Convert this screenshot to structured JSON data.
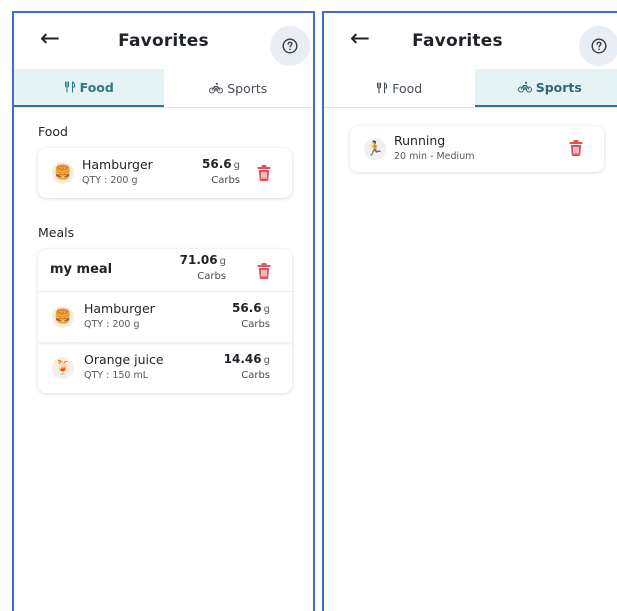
{
  "screens": [
    {
      "header": {
        "title": "Favorites",
        "back_icon": "arrow-left-icon",
        "help_icon": "help-circle-icon"
      },
      "tabs": [
        {
          "label": "Food",
          "icon": "fork-knife-icon",
          "active": true
        },
        {
          "label": "Sports",
          "icon": "bicycle-icon",
          "active": false
        }
      ],
      "food_section": {
        "label": "Food",
        "items": [
          {
            "name": "Hamburger",
            "qty": "QTY : 200 g",
            "amount": "56.6",
            "unit": "g",
            "nutrient": "Carbs",
            "emoji": "🍔"
          }
        ]
      },
      "meals_section": {
        "label": "Meals",
        "meals": [
          {
            "name": "my meal",
            "amount": "71.06",
            "unit": "g",
            "nutrient": "Carbs",
            "items": [
              {
                "name": "Hamburger",
                "qty": "QTY : 200 g",
                "amount": "56.6",
                "unit": "g",
                "nutrient": "Carbs",
                "emoji": "🍔"
              },
              {
                "name": "Orange juice",
                "qty": "QTY : 150 mL",
                "amount": "14.46",
                "unit": "g",
                "nutrient": "Carbs",
                "emoji": "🍹"
              }
            ]
          }
        ]
      }
    },
    {
      "header": {
        "title": "Favorites",
        "back_icon": "arrow-left-icon",
        "help_icon": "help-circle-icon"
      },
      "tabs": [
        {
          "label": "Food",
          "icon": "fork-knife-icon",
          "active": false
        },
        {
          "label": "Sports",
          "icon": "bicycle-icon",
          "active": true
        }
      ],
      "sports": [
        {
          "name": "Running",
          "detail": "20 min - Medium",
          "emoji": "🏃"
        }
      ]
    }
  ],
  "colors": {
    "accent": "#2f7a83",
    "tab_active_bg": "#e6f3f4",
    "trash": "#e0525e",
    "help_bg": "#e9eef5",
    "frame_border": "#3f6fc2"
  }
}
